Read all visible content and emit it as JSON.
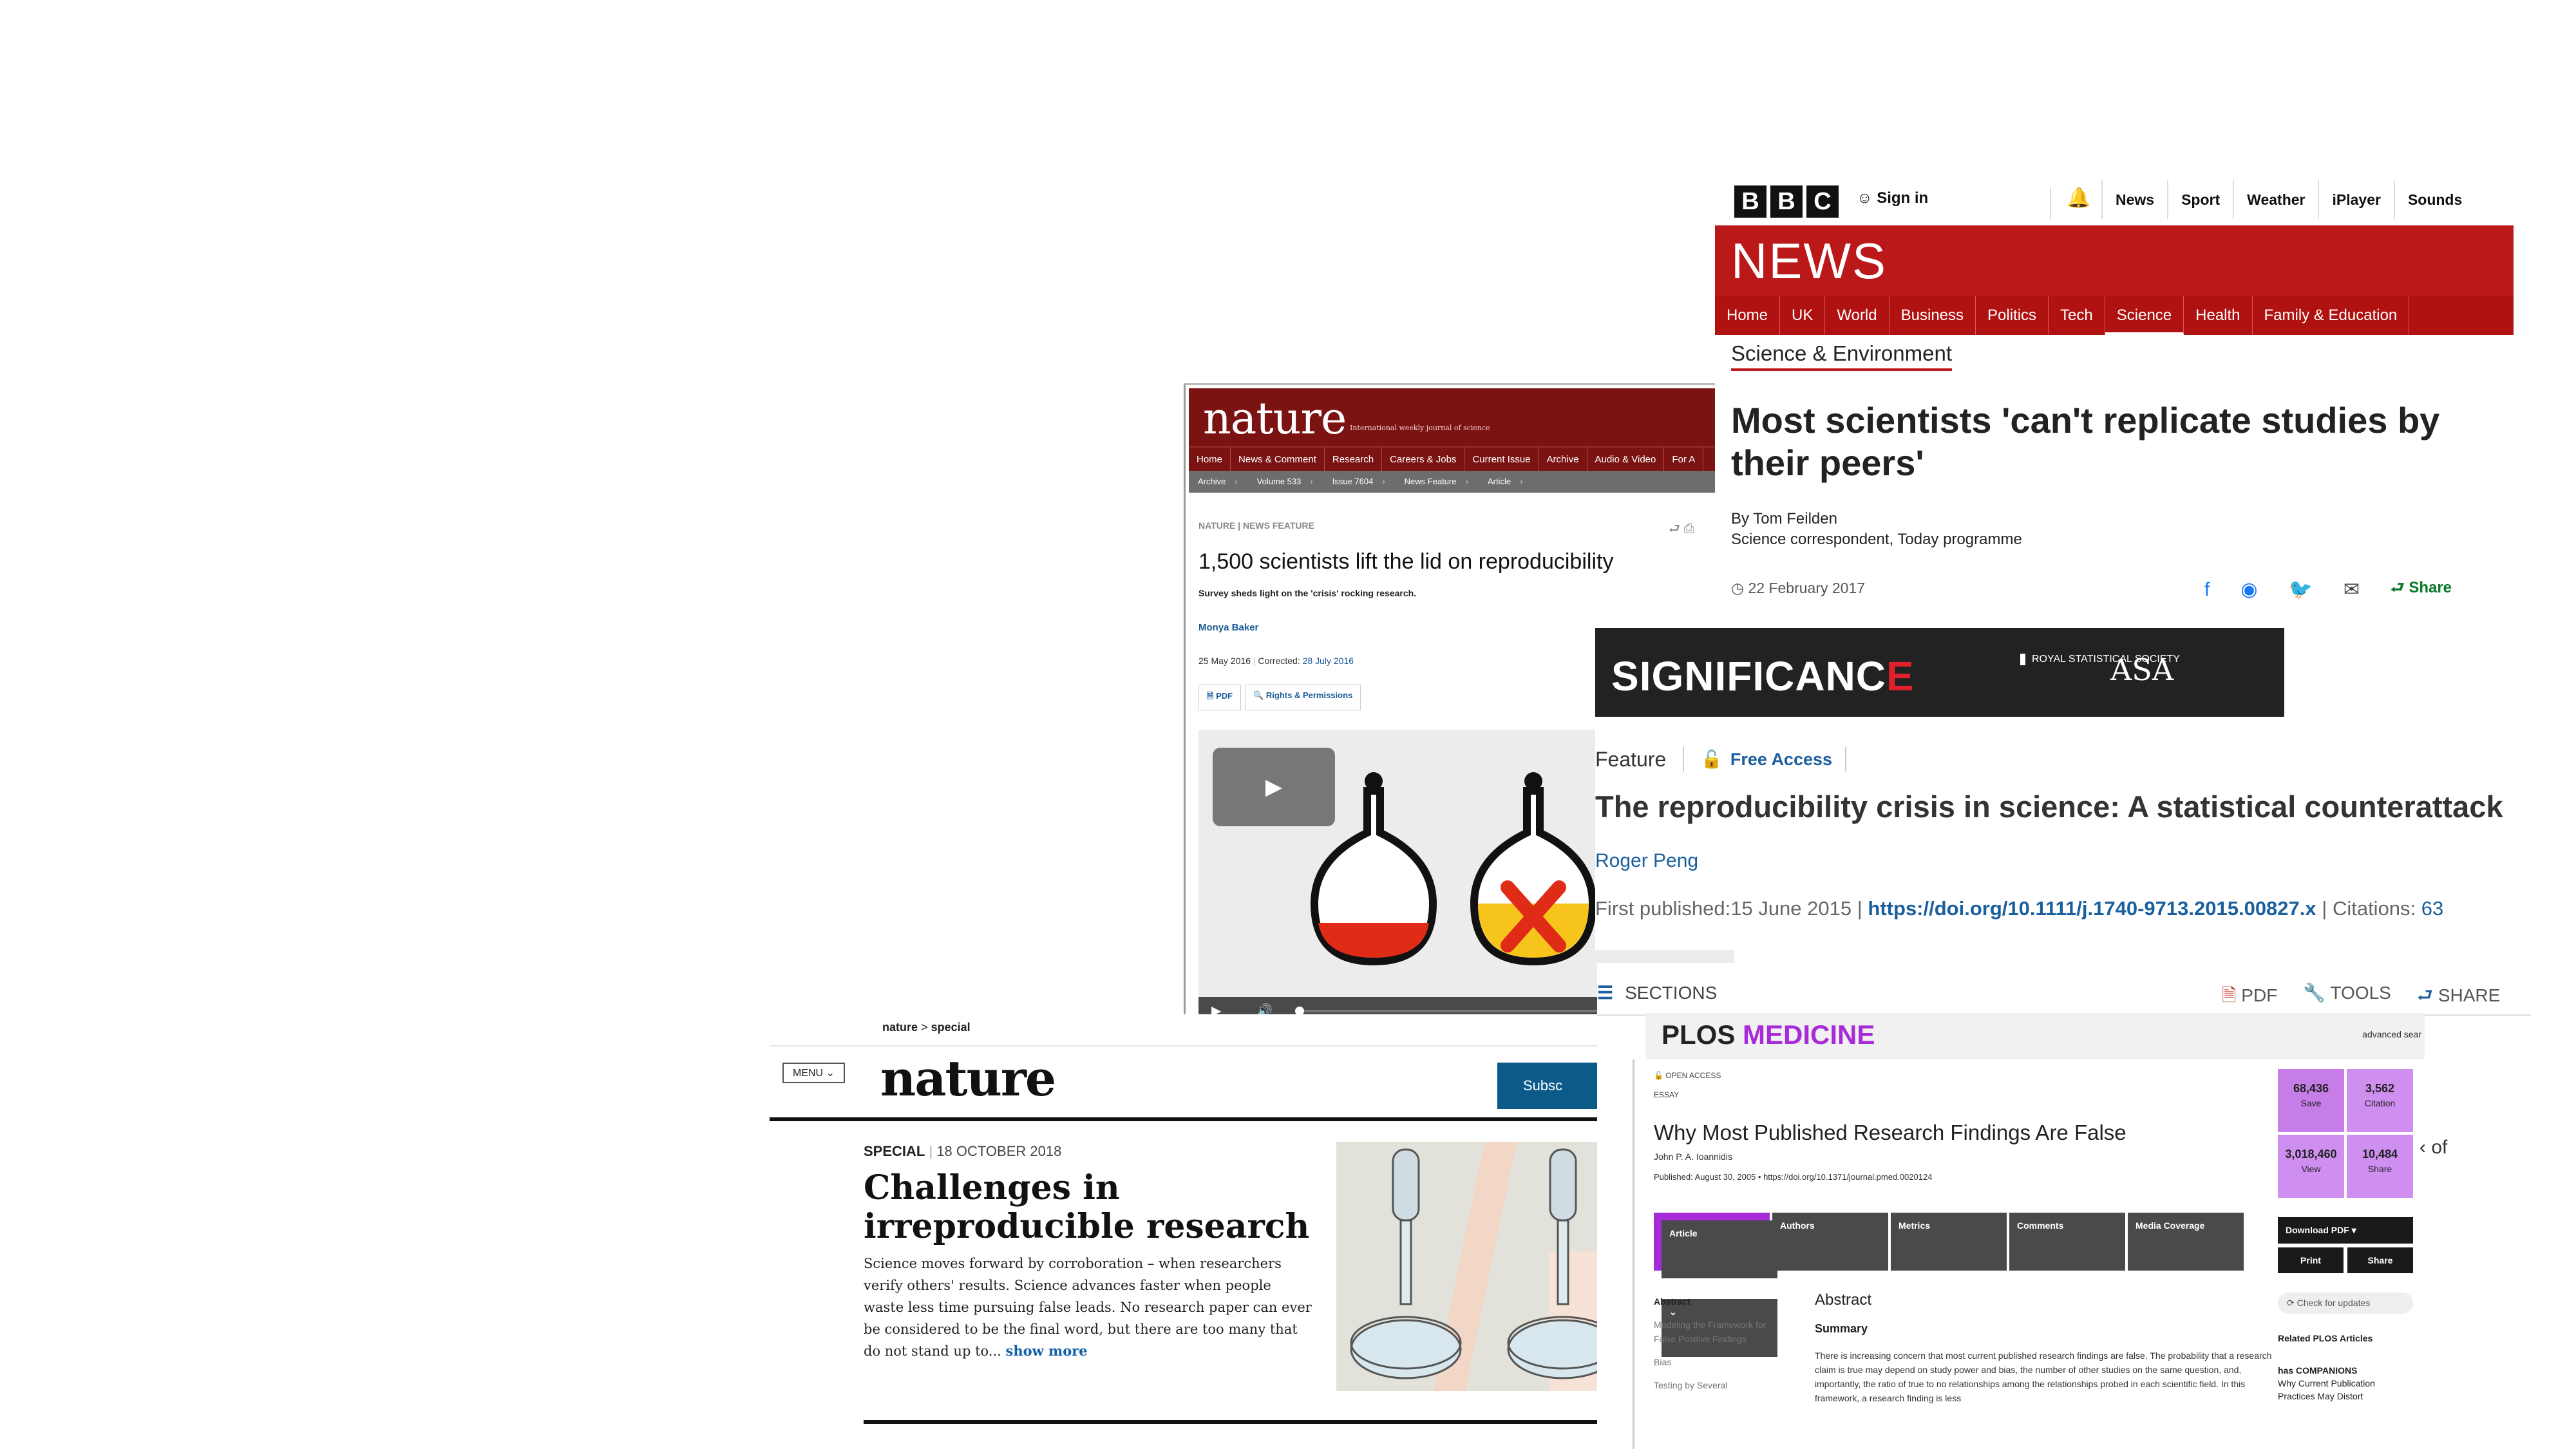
{
  "nature_feature": {
    "logo": "nature",
    "tagline": "International weekly journal of science",
    "nav": [
      "Home",
      "News & Comment",
      "Research",
      "Careers & Jobs",
      "Current Issue",
      "Archive",
      "Audio & Video",
      "For A"
    ],
    "crumbs": [
      "Archive",
      "Volume 533",
      "Issue 7604",
      "News Feature",
      "Article"
    ],
    "kicker": "NATURE | NEWS FEATURE",
    "title": "1,500 scientists lift the lid on reproducibility",
    "subtitle": "Survey sheds light on the 'crisis' rocking research.",
    "author": "Monya Baker",
    "date": "25 May 2016",
    "corrected_label": "Corrected:",
    "corrected_date": "28 July 2016",
    "pdf": "PDF",
    "rights": "Rights & Permissions"
  },
  "nature_special": {
    "crumb_home": "nature",
    "crumb_sep": ">",
    "crumb_section": "special",
    "menu": "MENU",
    "logo": "nature",
    "subscribe": "Subsc",
    "kicker_type": "SPECIAL",
    "kicker_date": "18 OCTOBER 2018",
    "title": "Challenges in irreproducible research",
    "body": "Science moves forward by corroboration – when researchers verify others' results. Science advances faster when people waste less time pursuing false leads. No research paper can ever be considered to be the final word, but there are too many that do not stand up to...",
    "more": "show more"
  },
  "bbc": {
    "logo": [
      "B",
      "B",
      "C"
    ],
    "sign_in": "Sign in",
    "top_nav": [
      "News",
      "Sport",
      "Weather",
      "iPlayer",
      "Sounds"
    ],
    "brand": "NEWS",
    "nav": [
      "Home",
      "UK",
      "World",
      "Business",
      "Politics",
      "Tech",
      "Science",
      "Health",
      "Family & Education"
    ],
    "active_nav": "Science",
    "section": "Science & Environment",
    "title": "Most scientists 'can't replicate studies by their peers'",
    "byline": "By Tom Feilden",
    "role": "Science correspondent, Today programme",
    "date": "22 February 2017",
    "share": "Share"
  },
  "significance": {
    "name_main": "SIGNIFICANC",
    "name_e": "E",
    "rss": "ROYAL STATISTICAL SOCIETY",
    "asa": "ASA",
    "type": "Feature",
    "access": "Free Access",
    "title": "The reproducibility crisis in science: A statistical counterattack",
    "author": "Roger Peng",
    "published_label": "First published:",
    "published_date": "15 June 2015",
    "doi": "https://doi.org/10.1111/j.1740-9713.2015.00827.x",
    "citations_label": "Citations:",
    "citations": "63"
  },
  "plos": {
    "sections": "SECTIONS",
    "pdf": "PDF",
    "tools": "TOOLS",
    "share": "SHARE",
    "brand_main": "PLOS",
    "brand_sub": "MEDICINE",
    "advanced": "advanced sear",
    "open_access": "OPEN ACCESS",
    "essay": "ESSAY",
    "title": "Why Most Published Research Findings Are False",
    "author": "John P. A. Ioannidis",
    "published": "Published: August 30, 2005 • https://doi.org/10.1371/journal.pmed.0020124",
    "tabs": [
      "Article",
      "Authors",
      "Metrics",
      "Comments",
      "Media Coverage"
    ],
    "side": [
      "Abstract",
      "Modeling the Framework for False Positive Findings",
      "Bias",
      "Testing by Several"
    ],
    "abstract_h": "Abstract",
    "summary_h": "Summary",
    "summary": "There is increasing concern that most current published research findings are false. The probability that a research claim is true may depend on study power and bias, the number of other studies on the same question, and, importantly, the ratio of true to no relationships among the relationships probed in each scientific field. In this framework, a research finding is less",
    "metrics": [
      {
        "value": "68,436",
        "label": "Save"
      },
      {
        "value": "3,562",
        "label": "Citation"
      },
      {
        "value": "3,018,460",
        "label": "View"
      },
      {
        "value": "10,484",
        "label": "Share"
      }
    ],
    "of": "‹ of",
    "download": "Download PDF",
    "print": "Print",
    "share_btn": "Share",
    "check": "Check for updates",
    "related": "Related PLOS Articles",
    "companions": "has COMPANIONS",
    "companion_text": "Why Current Publication Practices May Distort"
  }
}
